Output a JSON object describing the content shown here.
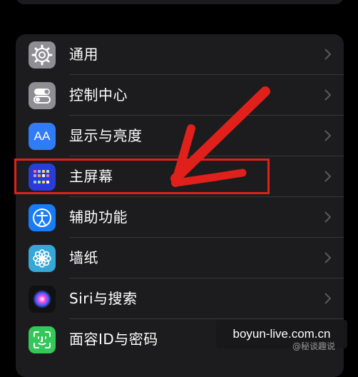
{
  "settings": {
    "items": [
      {
        "label": "通用",
        "icon": "gear-icon",
        "icon_bg": "#8e8e93"
      },
      {
        "label": "控制中心",
        "icon": "toggles-icon",
        "icon_bg": "#8e8e93"
      },
      {
        "label": "显示与亮度",
        "icon": "text-size-icon",
        "icon_bg": "#2f7cf6",
        "icon_text": "AA"
      },
      {
        "label": "主屏幕",
        "icon": "home-screen-icon",
        "icon_bg": "#2a3bd8"
      },
      {
        "label": "辅助功能",
        "icon": "accessibility-icon",
        "icon_bg": "#1a7cf5"
      },
      {
        "label": "墙纸",
        "icon": "flower-icon",
        "icon_bg": "#35a7d8"
      },
      {
        "label": "Siri与搜索",
        "icon": "siri-icon",
        "icon_bg": "#111111"
      },
      {
        "label": "面容ID与密码",
        "icon": "face-id-icon",
        "icon_bg": "#34c759"
      }
    ]
  },
  "annotation": {
    "highlight_color": "#e0201a"
  },
  "watermark": {
    "site": "boyun-live.com.cn",
    "handle": "@秘谈趣说"
  }
}
